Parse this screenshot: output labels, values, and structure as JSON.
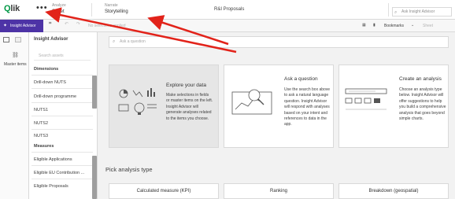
{
  "header": {
    "logo_text": "Qlik",
    "logo_q": "Q",
    "menu_dots": "•••",
    "crumb_analyze_small": "Analyze",
    "crumb_analyze_big": "Sheet",
    "crumb_narrate_small": "Narrate",
    "crumb_narrate_big": "Storytelling",
    "app_title": "R&I Proposals",
    "search_placeholder": "Ask Insight Advisor"
  },
  "toolbar": {
    "insight_advisor_label": "Insight Advisor",
    "selections_text": "No selections applied",
    "bookmarks_label": "Bookmarks",
    "sheet_label": "Sheet"
  },
  "rail": {
    "master_items_label": "Master items"
  },
  "panel": {
    "title": "Insight Advisor",
    "search_placeholder": "Search assets",
    "dimensions_header": "Dimensions",
    "dimensions": [
      "Drill-down NUTS",
      "Drill-down programme",
      "NUTS1",
      "NUTS2",
      "NUTS3"
    ],
    "measures_header": "Measures",
    "measures": [
      "Eligible Applications",
      "Eligible EU Contribution ...",
      "Eligible Proposals"
    ]
  },
  "main": {
    "ask_placeholder": "Ask a question",
    "cards": [
      {
        "title": "Explore your data",
        "body": "Make selections in fields or master items on the left. Insight Advisor will generate analyses related to the items you choose."
      },
      {
        "title": "Ask a question",
        "body": "Use the search box above to ask a natural language question. Insight Advisor will respond with analyses based on your intent and references to data in the app."
      },
      {
        "title": "Create an analysis",
        "body": "Choose an analysis type below. Insight Advisor will offer suggestions to help you build a comprehensive analysis that goes beyond simple charts."
      }
    ],
    "pick_title": "Pick analysis type",
    "analysis_types": [
      "Calculated measure (KPI)",
      "Ranking",
      "Breakdown (geospatial)"
    ]
  },
  "colors": {
    "brand_green": "#009845",
    "insight_purple": "#4d33a6",
    "arrow_red": "#e2231a"
  }
}
